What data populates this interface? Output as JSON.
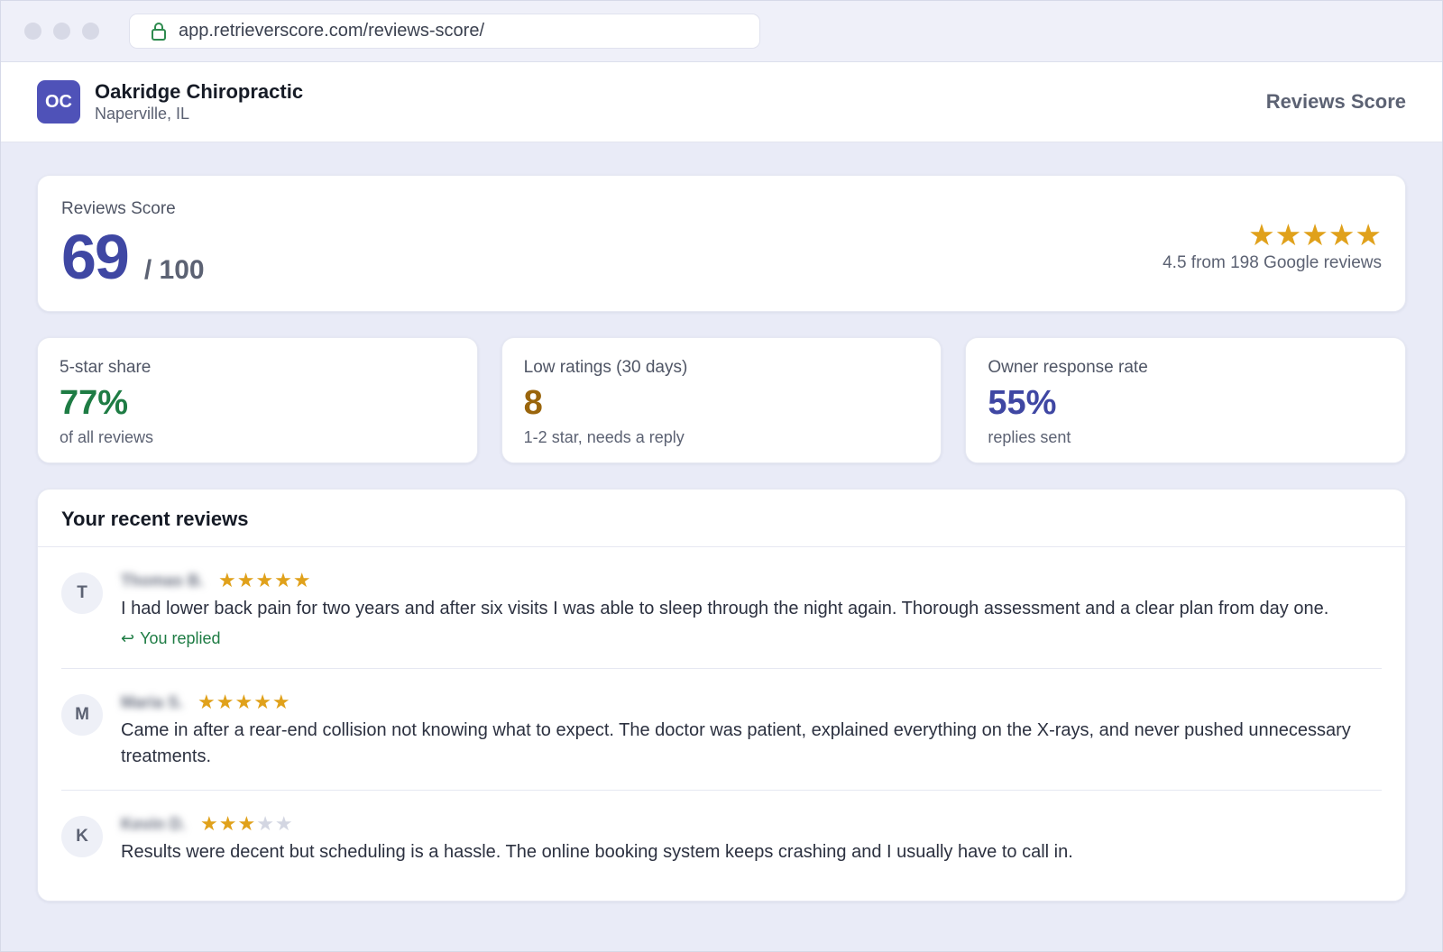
{
  "browser": {
    "url": "app.retrieverscore.com/reviews-score/"
  },
  "header": {
    "logo_initials": "OC",
    "business_name": "Oakridge Chiropractic",
    "location": "Naperville, IL",
    "page_title": "Reviews Score"
  },
  "score": {
    "label": "Reviews Score",
    "value": "69",
    "max": "/ 100",
    "stars": "★★★★★",
    "rating_summary": "4.5 from 198 Google reviews"
  },
  "stats": [
    {
      "label": "5-star share",
      "value": "77%",
      "sub": "of all reviews",
      "color": "#1e7c44"
    },
    {
      "label": "Low ratings (30 days)",
      "value": "8",
      "sub": "1-2 star, needs a reply",
      "color": "#9a650c"
    },
    {
      "label": "Owner response rate",
      "value": "55%",
      "sub": "replies sent",
      "color": "#3f47a3"
    }
  ],
  "reviews": {
    "title": "Your recent reviews",
    "items": [
      {
        "initial": "T",
        "name": "Thomas B.",
        "rating": 5,
        "stars_on": "★★★★★",
        "stars_off": "",
        "text": "I had lower back pain for two years and after six visits I was able to sleep through the night again. Thorough assessment and a clear plan from day one.",
        "reply_status": "You replied"
      },
      {
        "initial": "M",
        "name": "Maria S.",
        "rating": 5,
        "stars_on": "★★★★★",
        "stars_off": "",
        "text": "Came in after a rear-end collision not knowing what to expect. The doctor was patient, explained everything on the X-rays, and never pushed unnecessary treatments."
      },
      {
        "initial": "K",
        "name": "Kevin D.",
        "rating": 3,
        "stars_on": "★★★",
        "stars_off": "★★",
        "text": "Results were decent but scheduling is a hassle. The online booking system keeps crashing and I usually have to call in."
      }
    ]
  },
  "colors": {
    "accent": "#3f47a3",
    "star": "#e0a11b",
    "logo_bg": "#4f52b8"
  }
}
